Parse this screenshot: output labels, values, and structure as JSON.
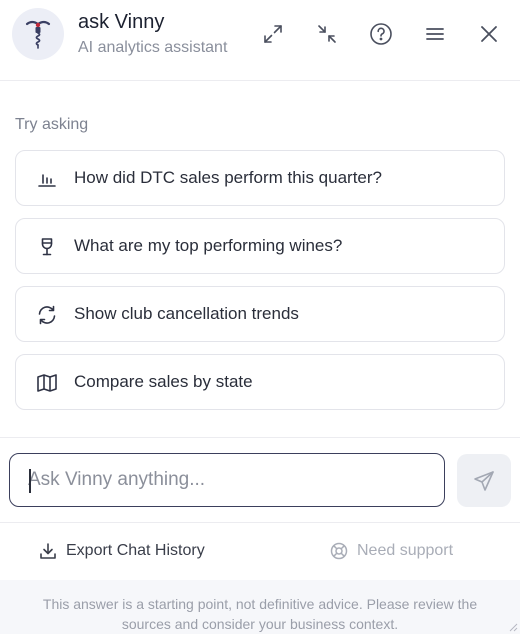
{
  "header": {
    "title": "ask Vinny",
    "subtitle": "AI analytics assistant",
    "avatar_icon": "corkscrew-icon",
    "buttons": [
      "expand-icon",
      "collapse-icon",
      "help-icon",
      "menu-icon",
      "close-icon"
    ]
  },
  "suggestions": {
    "heading": "Try asking",
    "items": [
      {
        "icon": "bar-chart-icon",
        "label": "How did DTC sales perform this quarter?"
      },
      {
        "icon": "wine-glass-icon",
        "label": "What are my top performing wines?"
      },
      {
        "icon": "refresh-icon",
        "label": "Show club cancellation trends"
      },
      {
        "icon": "map-icon",
        "label": "Compare sales by state"
      }
    ]
  },
  "composer": {
    "placeholder": "Ask Vinny anything...",
    "value": "",
    "send_icon": "send-icon"
  },
  "footer": {
    "export_label": "Export Chat History",
    "support_label": "Need support",
    "disclaimer": "This answer is a starting point, not definitive advice. Please review the sources and consider your business context."
  },
  "colors": {
    "accent": "#3b3f5c",
    "avatar_bg": "#eceef6",
    "muted_text": "#8a8f9c"
  }
}
